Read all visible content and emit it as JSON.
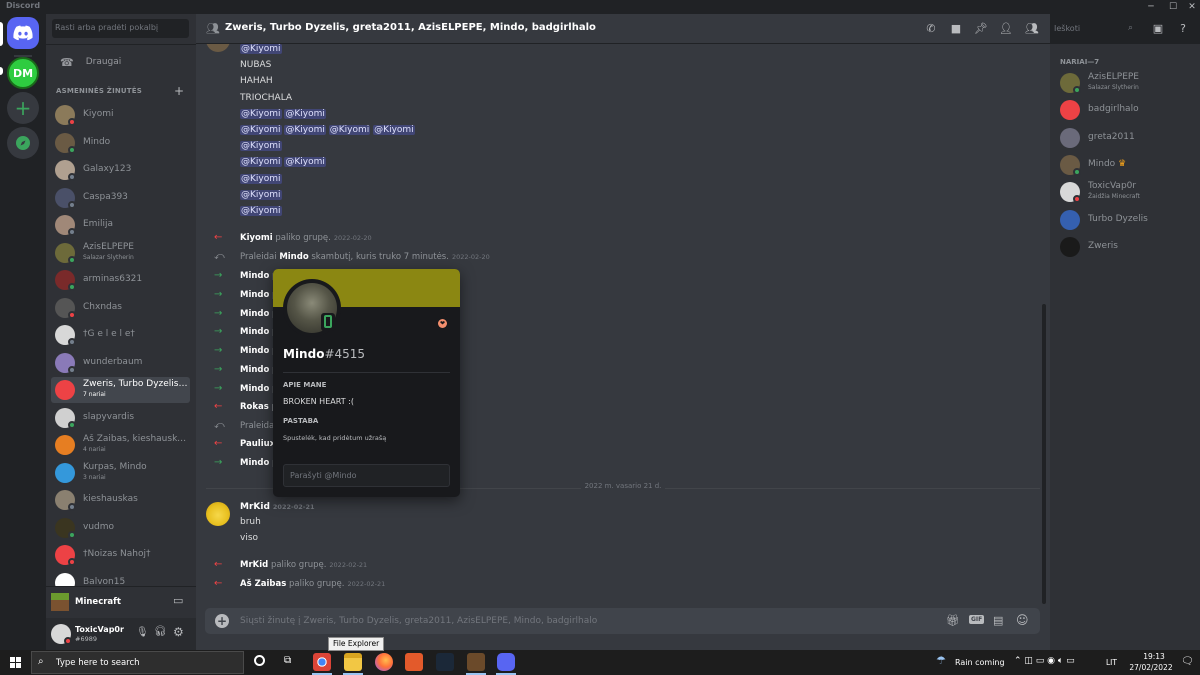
{
  "window": {
    "title": "Discord",
    "min": "─",
    "max": "☐",
    "close": "✕"
  },
  "sidebar": {
    "search_placeholder": "Rasti arba pradėti pokalbį",
    "friends_label": "Draugai",
    "dm_header": "ASMENINĖS ŽINUTĖS",
    "dms": [
      {
        "name": "Kiyomi",
        "sub": "",
        "status": "#ed4245",
        "avatar": "#8b7a5a"
      },
      {
        "name": "Mindo",
        "sub": "",
        "status": "#3ba55d",
        "avatar": "#6a5a44"
      },
      {
        "name": "Galaxy123",
        "sub": "",
        "status": "#747f8d",
        "avatar": "#b0a090"
      },
      {
        "name": "Caspa393",
        "sub": "",
        "status": "#747f8d",
        "avatar": "#4a5068"
      },
      {
        "name": "Emilija",
        "sub": "",
        "status": "#747f8d",
        "avatar": "#a08878"
      },
      {
        "name": "AzisELPEPE",
        "sub": "Salazar Slytherin",
        "status": "#3ba55d",
        "avatar": "#6d6a3a"
      },
      {
        "name": "arminas6321",
        "sub": "",
        "status": "#3ba55d",
        "avatar": "#7a2a2a"
      },
      {
        "name": "Chxndas",
        "sub": "",
        "status": "#ed4245",
        "avatar": "#555555"
      },
      {
        "name": "†G e l e l e†",
        "sub": "",
        "status": "#747f8d",
        "avatar": "#d8d8d8"
      },
      {
        "name": "wunderbaum",
        "sub": "",
        "status": "#747f8d",
        "avatar": "#8a7ab8"
      },
      {
        "name": "Zweris, Turbo Dyzelis, gr...",
        "sub": "7 nariai",
        "status": "",
        "avatar": "#ed4245"
      },
      {
        "name": "slapyvardis",
        "sub": "",
        "status": "#3ba55d",
        "avatar": "#d0d0d0"
      },
      {
        "name": "Aš Zaibas, kieshauskas, ...",
        "sub": "4 nariai",
        "status": "",
        "avatar": "#e67e22"
      },
      {
        "name": "Kurpas, Mindo",
        "sub": "3 nariai",
        "status": "",
        "avatar": "#3498db"
      },
      {
        "name": "kieshauskas",
        "sub": "",
        "status": "#747f8d",
        "avatar": "#8a8070"
      },
      {
        "name": "vudmo",
        "sub": "",
        "status": "#3ba55d",
        "avatar": "#3a3520"
      },
      {
        "name": "†Noizas Nahoj†",
        "sub": "",
        "status": "#ed4245",
        "avatar": "#ed4245"
      },
      {
        "name": "Balvon15",
        "sub": "",
        "status": "",
        "avatar": "#ffffff"
      }
    ]
  },
  "activity": {
    "label": "Minecraft"
  },
  "user": {
    "name": "ToxicVap0r",
    "tag": "#6989"
  },
  "header": {
    "title": "Zweris, Turbo Dyzelis, greta2011, AzisELPEPE, Mindo, badgirlhalo",
    "search_placeholder": "Ieškoti"
  },
  "messages": {
    "lines": [
      {
        "parts": [
          {
            "t": "@Kiyomi",
            "m": true
          }
        ]
      },
      {
        "parts": [
          {
            "t": "NUBAS",
            "m": false
          }
        ]
      },
      {
        "parts": [
          {
            "t": "HAHAH",
            "m": false
          }
        ]
      },
      {
        "parts": [
          {
            "t": "TRIOCHALA",
            "m": false
          }
        ]
      },
      {
        "parts": [
          {
            "t": "@Kiyomi",
            "m": true
          },
          {
            "t": " ",
            "m": false
          },
          {
            "t": "@Kiyomi",
            "m": true
          }
        ]
      },
      {
        "parts": [
          {
            "t": "@Kiyomi",
            "m": true
          },
          {
            "t": " ",
            "m": false
          },
          {
            "t": "@Kiyomi",
            "m": true
          },
          {
            "t": " ",
            "m": false
          },
          {
            "t": "@Kiyomi",
            "m": true
          },
          {
            "t": " ",
            "m": false
          },
          {
            "t": "@Kiyomi",
            "m": true
          }
        ]
      },
      {
        "parts": [
          {
            "t": "@Kiyomi",
            "m": true
          }
        ]
      },
      {
        "parts": [
          {
            "t": "@Kiyomi",
            "m": true
          },
          {
            "t": " ",
            "m": false
          },
          {
            "t": "@Kiyomi",
            "m": true
          }
        ]
      },
      {
        "parts": [
          {
            "t": "@Kiyomi",
            "m": true
          }
        ]
      },
      {
        "parts": [
          {
            "t": "@Kiyomi",
            "m": true
          }
        ]
      },
      {
        "parts": [
          {
            "t": "@Kiyomi",
            "m": true
          }
        ]
      }
    ],
    "system": [
      {
        "type": "leave",
        "bold": "Kiyomi",
        "text": " paliko grupę.",
        "ts": "2022-02-20"
      },
      {
        "type": "call",
        "pre": "Praleidai ",
        "bold": "Mindo",
        "text": " skambutį, kuris truko 7 minutės.",
        "ts": "2022-02-20"
      },
      {
        "type": "join",
        "bold": "Mindo",
        "text": " p",
        "ts": ""
      },
      {
        "type": "join",
        "bold": "Mindo",
        "text": " p",
        "ts": ""
      },
      {
        "type": "join",
        "bold": "Mindo",
        "text": " p",
        "ts": ""
      },
      {
        "type": "join",
        "bold": "Mindo",
        "text": " p",
        "ts": ""
      },
      {
        "type": "join",
        "bold": "Mindo",
        "text": " p",
        "ts": ""
      },
      {
        "type": "join",
        "bold": "Mindo",
        "text": " p",
        "ts": ""
      },
      {
        "type": "join",
        "bold": "Mindo",
        "text": " p",
        "ts": ""
      },
      {
        "type": "leave",
        "bold": "Rokas",
        "text": " p",
        "ts": ""
      },
      {
        "type": "call",
        "pre": "Praleidai",
        "bold": "",
        "text": "",
        "ts": "2-20"
      },
      {
        "type": "leave",
        "bold": "Pauliuxx",
        "text": "",
        "ts": ""
      },
      {
        "type": "join",
        "bold": "Mindo",
        "text": " p",
        "ts": ""
      }
    ],
    "divider": "2022 m. vasario 21 d.",
    "mrkid": {
      "author": "MrKid",
      "ts": "2022-02-21",
      "lines": [
        "bruh",
        "viso"
      ]
    },
    "after": [
      {
        "type": "leave",
        "bold": "MrKid",
        "text": " paliko grupę.",
        "ts": "2022-02-21"
      },
      {
        "type": "leave",
        "bold": "Aš Zaibas",
        "text": " paliko grupę.",
        "ts": "2022-02-21"
      }
    ],
    "composer_placeholder": "Siųsti žinutę į Zweris, Turbo Dyzelis, greta2011, AzisELPEPE, Mindo, badgirlhalo"
  },
  "popout": {
    "username": "Mindo",
    "discriminator": "#4515",
    "banner_color": "#8b8712",
    "about_label": "APIE MANE",
    "about_text": "BROKEN HEART :(",
    "note_label": "PASTABA",
    "note_placeholder": "Spustelėk, kad pridėtum užrašą",
    "message_placeholder": "Parašyti @Mindo"
  },
  "members": {
    "header": "NARIAI—7",
    "list": [
      {
        "name": "AzisELPEPE",
        "sub": "Salazar Slytherin",
        "status": "#3ba55d",
        "avatar": "#6d6a3a",
        "crown": ""
      },
      {
        "name": "badgirlhalo",
        "sub": "",
        "status": "",
        "avatar": "#ed4245",
        "crown": ""
      },
      {
        "name": "greta2011",
        "sub": "",
        "status": "",
        "avatar": "#6a6a7a",
        "crown": ""
      },
      {
        "name": "Mindo",
        "sub": "",
        "status": "#3ba55d",
        "avatar": "#6a5a44",
        "crown": "♛"
      },
      {
        "name": "ToxicVap0r",
        "sub": "Žaidžia Minecraft",
        "status": "#ed4245",
        "avatar": "#d8d8d8",
        "crown": ""
      },
      {
        "name": "Turbo Dyzelis",
        "sub": "",
        "status": "",
        "avatar": "#3560b0",
        "crown": ""
      },
      {
        "name": "Zweris",
        "sub": "",
        "status": "",
        "avatar": "#1a1a1a",
        "crown": ""
      }
    ]
  },
  "tooltip": "File Explorer",
  "taskbar": {
    "search_placeholder": "Type here to search",
    "weather": "Rain coming",
    "lang": "LIT",
    "time": "19:13",
    "date": "27/02/2022"
  }
}
